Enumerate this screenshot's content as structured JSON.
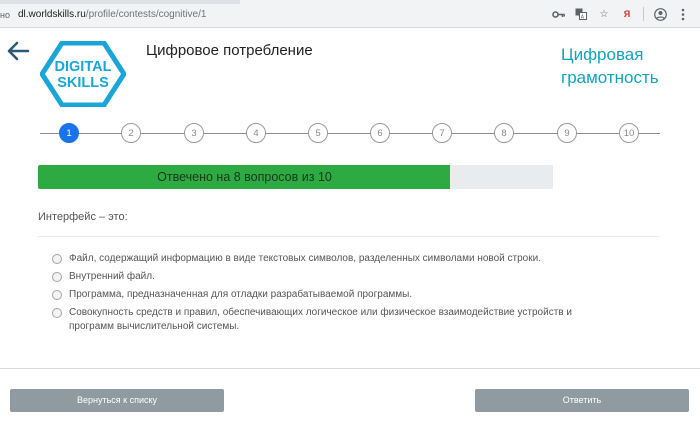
{
  "browser": {
    "nav_lead": "но",
    "url_domain": "dl.worldskills.ru",
    "url_path": "/profile/contests/cognitive/1",
    "ext_label": "Я"
  },
  "header": {
    "logo_line1": "DIGITAL",
    "logo_line2": "SKILLS",
    "page_title": "Цифровое потребление",
    "section_title": "Цифровая грамотность",
    "accent_color": "#14a3b8"
  },
  "stepper": {
    "steps": [
      "1",
      "2",
      "3",
      "4",
      "5",
      "6",
      "7",
      "8",
      "9",
      "10"
    ],
    "active_step": "1"
  },
  "progress": {
    "label": "Отвечено на 8 вопросов из 10",
    "answered": 8,
    "total": 10,
    "fill_color": "#2eaa42"
  },
  "question": {
    "text": "Интерфейс – это:",
    "options": [
      "Файл, содержащий информацию в виде текстовых символов, разделенных символами новой строки.",
      "Внутренний файл.",
      "Программа, предназначенная для отладки разрабатываемой программы.",
      "Совокупность средств и правил, обеспечивающих логическое или физическое взаимодействие устройств и программ вычислительной системы."
    ]
  },
  "footer": {
    "back_label": "Вернуться к списку",
    "answer_label": "Ответить"
  }
}
